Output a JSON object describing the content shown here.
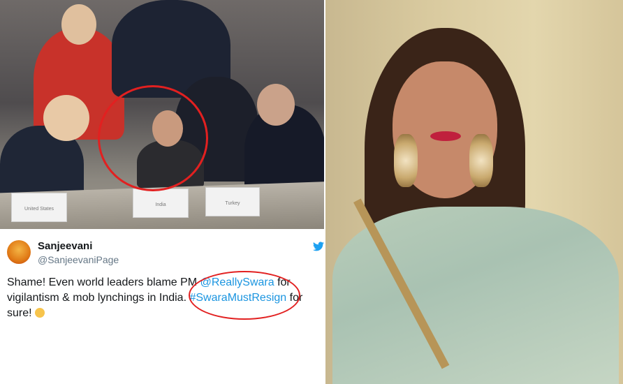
{
  "photo_meeting": {
    "nameplates": [
      "United States",
      "India",
      "Turkey"
    ]
  },
  "tweet": {
    "name": "Sanjeevani",
    "handle": "@SanjeevaniPage",
    "body_1": "Shame! Even world leaders blame PM ",
    "mention": "@ReallySwara",
    "body_2": " for vigilantism & mob lynchings in India. ",
    "hashtag": "#SwaraMustResign",
    "body_3": " for sure! "
  },
  "colors": {
    "link": "#1b95e0",
    "annotation_red": "#e22020",
    "text": "#14171a",
    "muted": "#657786"
  },
  "icons": {
    "twitter": "twitter-bird-icon",
    "emoji": "woman-shrugging-emoji-icon"
  }
}
